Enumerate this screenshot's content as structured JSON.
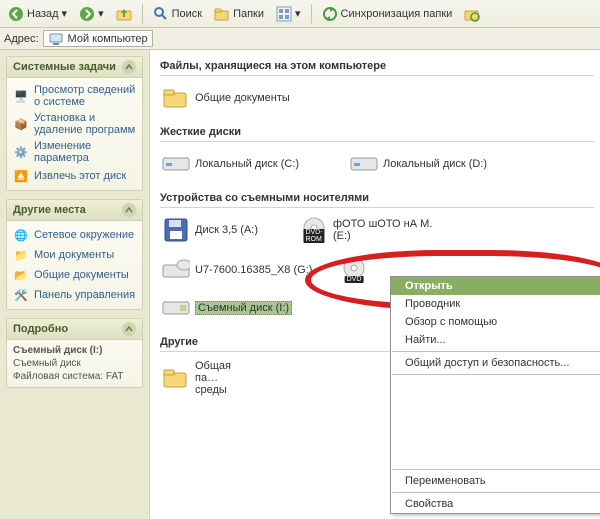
{
  "toolbar": {
    "back": "Назад",
    "search": "Поиск",
    "folders": "Папки",
    "sync": "Синхронизация папки"
  },
  "address": {
    "label": "Адрес:",
    "value": "Мой компьютер"
  },
  "sidebar": {
    "tasks": {
      "title": "Системные задачи",
      "items": [
        "Просмотр сведений о системе",
        "Установка и удаление программ",
        "Изменение параметра",
        "Извлечь этот диск"
      ]
    },
    "places": {
      "title": "Другие места",
      "items": [
        "Сетевое окружение",
        "Мои документы",
        "Общие документы",
        "Панель управления"
      ]
    },
    "details": {
      "title": "Подробно",
      "name": "Съемный диск (I:)",
      "type": "Съемный диск",
      "fs": "Файловая система: FAT"
    }
  },
  "content": {
    "g_files": "Файлы, хранящиеся на этом компьютере",
    "shared_docs": "Общие документы",
    "g_hdd": "Жесткие диски",
    "hdd": [
      "Локальный диск (C:)",
      "Локальный диск (D:)"
    ],
    "g_removable": "Устройства со съемными носителями",
    "rem": [
      "Диск 3,5 (A:)",
      "фОТО шОТО нА М. (E:)",
      "U7-7600.16385_X8 (G:)"
    ],
    "dvdrom": "DVD-ROM",
    "dvd": "DVD",
    "selected": "Съемный диск (I:)",
    "g_other": "Другие",
    "other_item": "Общая па… среды"
  },
  "menu": {
    "open": "Открыть",
    "explorer": "Проводник",
    "overview": "Обзор с помощью",
    "find": "Найти...",
    "share": "Общий доступ и безопасность...",
    "rename": "Переименовать",
    "props": "Свойства"
  }
}
